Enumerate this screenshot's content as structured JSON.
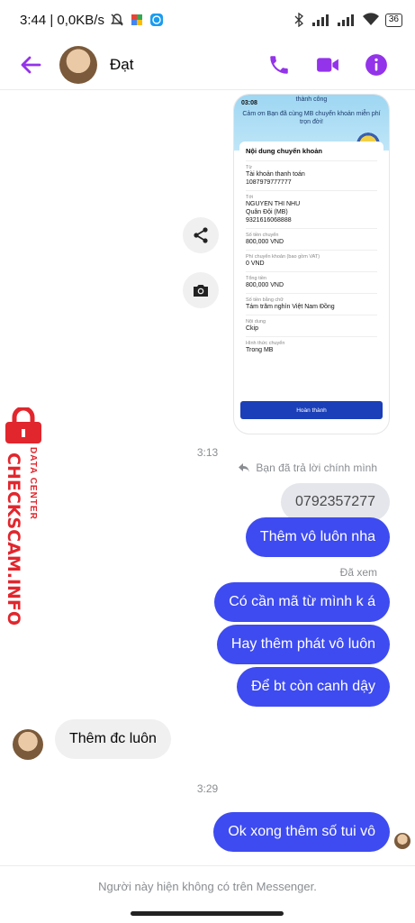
{
  "status_bar": {
    "time_net": "3:44 | 0,0KB/s",
    "battery": "36"
  },
  "header": {
    "contact_name": "Đạt",
    "accent": "#9333ea"
  },
  "shared_image": {
    "time": "03:08",
    "status_line": "thành công",
    "thanks": "Cảm ơn Bạn đã cùng MB chuyển khoản miễn phí trọn đời!",
    "card_title": "Nội dung chuyển khoản",
    "rows": [
      {
        "label": "Từ",
        "value": "Tài khoản thanh toán",
        "value2": "1087979777777"
      },
      {
        "label": "Tới",
        "value": "NGUYEN THI NHU",
        "value2": "Quân Đội (MB)",
        "value3": "9321616068888"
      },
      {
        "label": "Số tiền chuyển",
        "value": "800,000 VND"
      },
      {
        "label": "Phí chuyển khoản (bao gồm VAT)",
        "value": "0 VND"
      },
      {
        "label": "Tổng tiền",
        "value": "800,000 VND"
      },
      {
        "label": "Số tiền bằng chữ",
        "value": "Tám trăm nghìn Việt Nam Đồng"
      },
      {
        "label": "Nội dung",
        "value": "Ckip"
      },
      {
        "label": "Hình thức chuyển",
        "value": "Trong MB"
      }
    ],
    "done_button": "Hoàn thành"
  },
  "messages": {
    "ts1": "3:13",
    "reply_note": "Bạn đã trả lời chính mình",
    "quoted": "0792357277",
    "m1": "Thêm vô luôn nha",
    "seen": "Đã xem",
    "m2": "Có cần mã từ mình k á",
    "m3": "Hay thêm phát vô luôn",
    "m4": "Để bt còn canh dậy",
    "them1": "Thêm đc luôn",
    "ts2": "3:29",
    "m5": "Ok xong thêm số tui vô"
  },
  "footer": {
    "note": "Người này hiện không có trên Messenger."
  },
  "watermark": {
    "brand": "CHECKSCAM.INFO",
    "sub": "DATA CENTER"
  }
}
